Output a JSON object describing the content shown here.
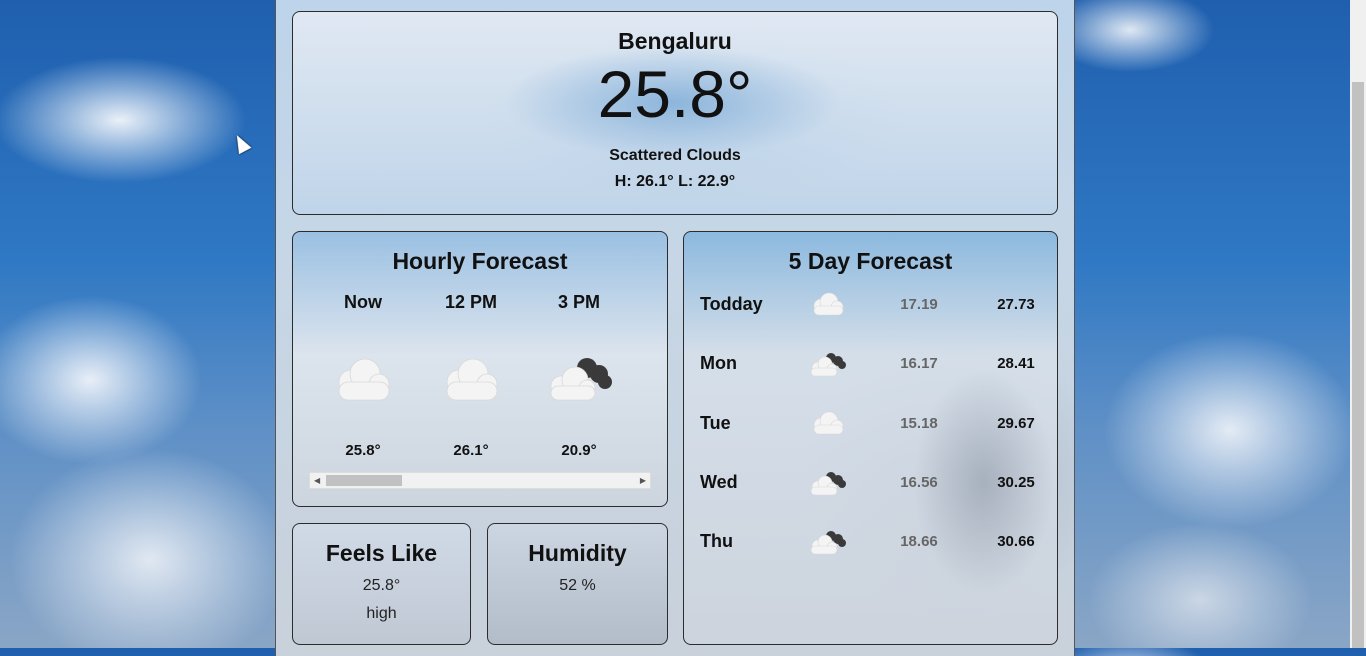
{
  "current": {
    "city": "Bengaluru",
    "temperature": "25.8°",
    "description": "Scattered Clouds",
    "high_low": "H: 26.1° L: 22.9°"
  },
  "hourly": {
    "title": "Hourly Forecast",
    "items": [
      {
        "time": "Now",
        "temp": "25.8°",
        "icon": "cloud-icon"
      },
      {
        "time": "12 PM",
        "temp": "26.1°",
        "icon": "cloud-icon"
      },
      {
        "time": "3 PM",
        "temp": "20.9°",
        "icon": "broken-clouds-icon"
      }
    ],
    "scroll_position": 0
  },
  "feels_like": {
    "title": "Feels Like",
    "value": "25.8°",
    "note": "high"
  },
  "humidity": {
    "title": "Humidity",
    "value": "52 %"
  },
  "daily": {
    "title": "5 Day Forecast",
    "days": [
      {
        "day": "Todday",
        "min": "17.19",
        "max": "27.73",
        "icon": "cloud-icon"
      },
      {
        "day": "Mon",
        "min": "16.17",
        "max": "28.41",
        "icon": "broken-clouds-icon"
      },
      {
        "day": "Tue",
        "min": "15.18",
        "max": "29.67",
        "icon": "cloud-icon"
      },
      {
        "day": "Wed",
        "min": "16.56",
        "max": "30.25",
        "icon": "broken-clouds-icon"
      },
      {
        "day": "Thu",
        "min": "18.66",
        "max": "30.66",
        "icon": "broken-clouds-icon"
      }
    ]
  }
}
